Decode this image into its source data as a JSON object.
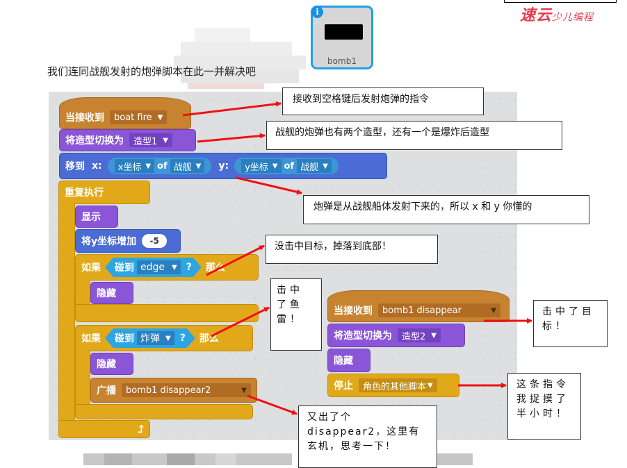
{
  "intro_text": "我们连同战舰发射的炮弹脚本在此一并解决吧",
  "sprite": {
    "name": "bomb1",
    "info_icon": "i"
  },
  "logo": {
    "main": "速云",
    "sub": "少儿编程"
  },
  "script1": {
    "hat": {
      "label": "当接收到",
      "message": "boat fire"
    },
    "switch_costume": {
      "label": "将造型切换为",
      "costume": "造型1"
    },
    "goto": {
      "label": "移到",
      "x_label": "x:",
      "x_attr": "x坐标",
      "of1": "of",
      "x_sprite": "战舰",
      "y_label": "y:",
      "y_attr": "y坐标",
      "of2": "of",
      "y_sprite": "战舰"
    },
    "forever": {
      "label": "重复执行"
    },
    "show": {
      "label": "显示"
    },
    "change_y": {
      "label": "将y坐标增加",
      "value": "-5"
    },
    "if1": {
      "label": "如果",
      "touching": "碰到",
      "target": "edge",
      "q": "?",
      "then": "那么"
    },
    "hide1": {
      "label": "隐藏"
    },
    "if2": {
      "label": "如果",
      "touching": "碰到",
      "target": "炸弹",
      "q": "?",
      "then": "那么"
    },
    "hide2": {
      "label": "隐藏"
    },
    "broadcast": {
      "label": "广播",
      "message": "bomb1 disappear2"
    }
  },
  "script2": {
    "hat": {
      "label": "当接收到",
      "message": "bomb1 disappear"
    },
    "switch_costume": {
      "label": "将造型切换为",
      "costume": "造型2"
    },
    "hide": {
      "label": "隐藏"
    },
    "stop": {
      "label": "停止",
      "option": "角色的其他脚本"
    }
  },
  "callouts": {
    "c1": "接收到空格键后发射炮弹的指令",
    "c2": "战舰的炮弹也有两个造型，还有一个是爆炸后造型",
    "c3": "炮弹是从战舰船体发射下来的，所以 x 和 y 你懂的",
    "c4": "没击中目标，掉落到底部！",
    "c5": "击中了鱼雷！",
    "c6": "击中了目标！",
    "c7": "这条指令我捉摸了半小时！",
    "c8": "又出了个 disappear2，这里有玄机，思考一下！"
  },
  "colors": {
    "events": "#c88330",
    "looks": "#8a55d7",
    "motion": "#4a6cd4",
    "control": "#e1a91a",
    "sensing": "#2ca5e2",
    "arrow": "#ee1111",
    "logo": "#e7384e"
  }
}
